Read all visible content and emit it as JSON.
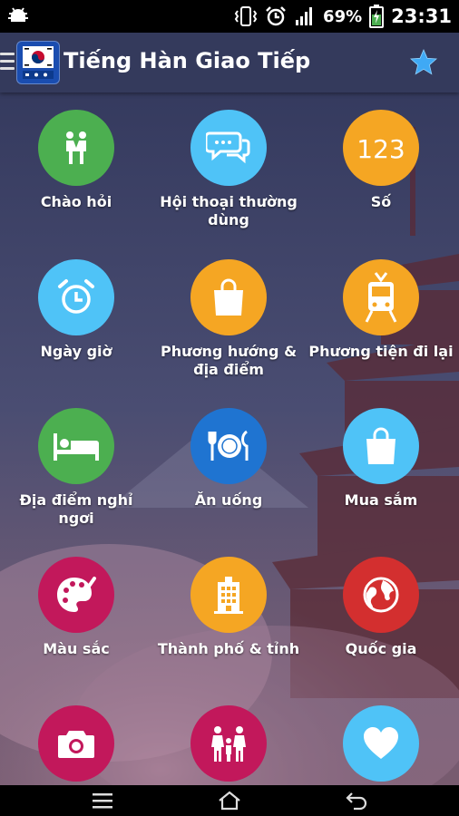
{
  "status_bar": {
    "battery_percent": "69%",
    "time": "23:31",
    "icons": [
      "android-debug-icon",
      "vibrate-icon",
      "alarm-icon",
      "signal-icon",
      "battery-charging-icon"
    ]
  },
  "app_bar": {
    "title": "Tiếng Hàn Giao Tiếp",
    "menu_icon": "menu-icon",
    "logo_icon": "korean-flag-app-icon",
    "star_icon": "star-icon"
  },
  "colors": {
    "green": "#4caf50",
    "light_blue": "#4fc3f7",
    "orange": "#f5a623",
    "blue": "#1f74d1",
    "crimson": "#c2185b",
    "red": "#d32f2f",
    "app_bar": "#343a5c",
    "star": "#3fa9f5"
  },
  "categories": [
    {
      "label": "Chào hỏi",
      "icon": "people-greeting-icon",
      "color": "#4caf50"
    },
    {
      "label": "Hội thoại thường dùng",
      "icon": "chat-bubbles-icon",
      "color": "#4fc3f7"
    },
    {
      "label": "Số",
      "icon": "numbers-123-icon",
      "color": "#f5a623"
    },
    {
      "label": "Ngày giờ",
      "icon": "alarm-clock-icon",
      "color": "#4fc3f7"
    },
    {
      "label": "Phương hướng & địa điểm",
      "icon": "bag-icon",
      "color": "#f5a623"
    },
    {
      "label": "Phương tiện đi lại",
      "icon": "tram-icon",
      "color": "#f5a623"
    },
    {
      "label": "Địa điểm nghỉ ngơi",
      "icon": "bed-icon",
      "color": "#4caf50"
    },
    {
      "label": "Ăn uống",
      "icon": "plate-cutlery-icon",
      "color": "#1f74d1"
    },
    {
      "label": "Mua sắm",
      "icon": "shopping-bag-icon",
      "color": "#4fc3f7"
    },
    {
      "label": "Màu sắc",
      "icon": "palette-icon",
      "color": "#c2185b"
    },
    {
      "label": "Thành phố & tỉnh",
      "icon": "building-icon",
      "color": "#f5a623"
    },
    {
      "label": "Quốc gia",
      "icon": "globe-icon",
      "color": "#d32f2f"
    },
    {
      "label": "",
      "icon": "camera-icon",
      "color": "#c2185b"
    },
    {
      "label": "",
      "icon": "family-icon",
      "color": "#c2185b"
    },
    {
      "label": "",
      "icon": "heart-icon",
      "color": "#4fc3f7"
    }
  ],
  "nav_bar": {
    "icons": [
      "menu-lines-icon",
      "home-icon",
      "back-icon"
    ]
  }
}
